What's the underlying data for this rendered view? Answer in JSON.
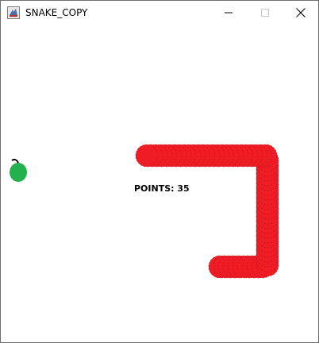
{
  "window": {
    "title": "SNAKE_COPY"
  },
  "score": {
    "label": "POINTS:",
    "value": "35"
  },
  "colors": {
    "snake": "#ee1c25",
    "apple": "#22b14c",
    "stem": "#000000"
  },
  "icons": {
    "app": "java-cup-icon",
    "minimize": "minimize-icon",
    "maximize": "maximize-icon",
    "close": "close-icon"
  }
}
